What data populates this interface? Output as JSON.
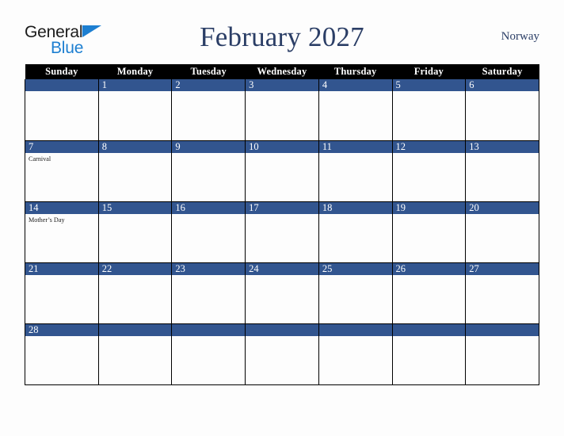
{
  "brand": {
    "name_part1": "General",
    "name_part2": "Blue",
    "accent_color": "#1d7fd1"
  },
  "header": {
    "title": "February 2027",
    "locale": "Norway",
    "title_color": "#2b3e66"
  },
  "calendar": {
    "month": "February",
    "year": "2027",
    "weekday_headers": [
      "Sunday",
      "Monday",
      "Tuesday",
      "Wednesday",
      "Thursday",
      "Friday",
      "Saturday"
    ],
    "header_bg": "#000000",
    "daynum_bg": "#32558f",
    "daynum_color": "#ffffff",
    "weeks": [
      [
        {
          "day": "",
          "events": []
        },
        {
          "day": "1",
          "events": []
        },
        {
          "day": "2",
          "events": []
        },
        {
          "day": "3",
          "events": []
        },
        {
          "day": "4",
          "events": []
        },
        {
          "day": "5",
          "events": []
        },
        {
          "day": "6",
          "events": []
        }
      ],
      [
        {
          "day": "7",
          "events": [
            "Carnival"
          ]
        },
        {
          "day": "8",
          "events": []
        },
        {
          "day": "9",
          "events": []
        },
        {
          "day": "10",
          "events": []
        },
        {
          "day": "11",
          "events": []
        },
        {
          "day": "12",
          "events": []
        },
        {
          "day": "13",
          "events": []
        }
      ],
      [
        {
          "day": "14",
          "events": [
            "Mother’s Day"
          ]
        },
        {
          "day": "15",
          "events": []
        },
        {
          "day": "16",
          "events": []
        },
        {
          "day": "17",
          "events": []
        },
        {
          "day": "18",
          "events": []
        },
        {
          "day": "19",
          "events": []
        },
        {
          "day": "20",
          "events": []
        }
      ],
      [
        {
          "day": "21",
          "events": []
        },
        {
          "day": "22",
          "events": []
        },
        {
          "day": "23",
          "events": []
        },
        {
          "day": "24",
          "events": []
        },
        {
          "day": "25",
          "events": []
        },
        {
          "day": "26",
          "events": []
        },
        {
          "day": "27",
          "events": []
        }
      ],
      [
        {
          "day": "28",
          "events": []
        },
        {
          "day": "",
          "events": []
        },
        {
          "day": "",
          "events": []
        },
        {
          "day": "",
          "events": []
        },
        {
          "day": "",
          "events": []
        },
        {
          "day": "",
          "events": []
        },
        {
          "day": "",
          "events": []
        }
      ]
    ]
  }
}
